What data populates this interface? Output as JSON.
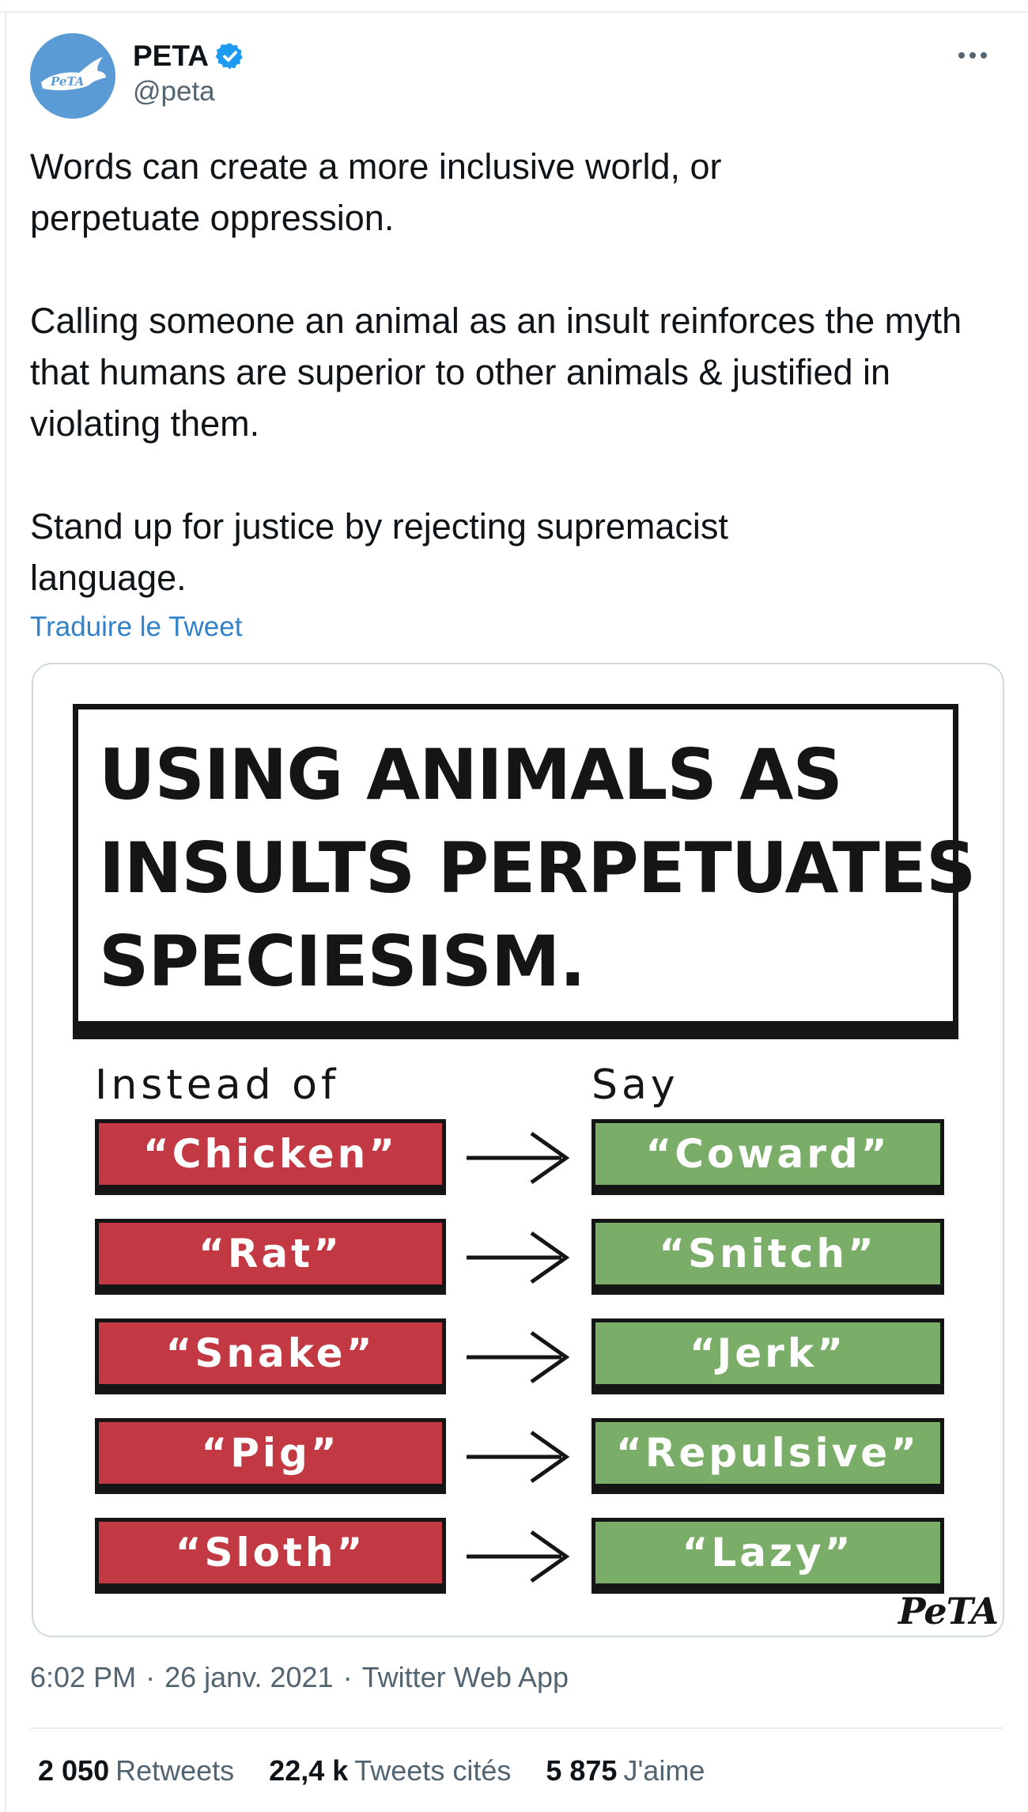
{
  "author": {
    "display_name": "PETA",
    "handle": "@peta",
    "verified": true,
    "avatar_icon": "peta-rabbit-logo",
    "avatar_text": "PeTA"
  },
  "tweet": {
    "paragraphs": [
      "Words can create a more inclusive world, or perpetuate oppression.",
      "Calling someone an animal as an insult reinforces the myth that humans are superior to other animals & justified in violating them.",
      "Stand up for justice by rejecting supremacist language."
    ],
    "translate_label": "Traduire le Tweet"
  },
  "image": {
    "headline_lines": [
      "USING ANIMALS AS",
      "INSULTS PERPETUATES",
      "SPECIESISM."
    ],
    "left_header": "Instead of",
    "right_header": "Say",
    "pairs": [
      {
        "instead": "“Chicken”",
        "say": "“Coward”"
      },
      {
        "instead": "“Rat”",
        "say": "“Snitch”"
      },
      {
        "instead": "“Snake”",
        "say": "“Jerk”"
      },
      {
        "instead": "“Pig”",
        "say": "“Repulsive”"
      },
      {
        "instead": "“Sloth”",
        "say": "“Lazy”"
      }
    ],
    "logo_text": "PeTA",
    "colors": {
      "red": "#c33943",
      "green": "#79ad68",
      "ink": "#151515"
    }
  },
  "meta": {
    "time": "6:02 PM",
    "date": "26 janv. 2021",
    "source": "Twitter Web App",
    "separator": "·"
  },
  "stats": {
    "retweets_count": "2 050",
    "retweets_label": "Retweets",
    "quotes_count": "22,4 k",
    "quotes_label": "Tweets cités",
    "likes_count": "5 875",
    "likes_label": "J'aime"
  },
  "colors": {
    "link": "#3182c8",
    "verified": "#1d9bf0",
    "muted": "#536471"
  }
}
